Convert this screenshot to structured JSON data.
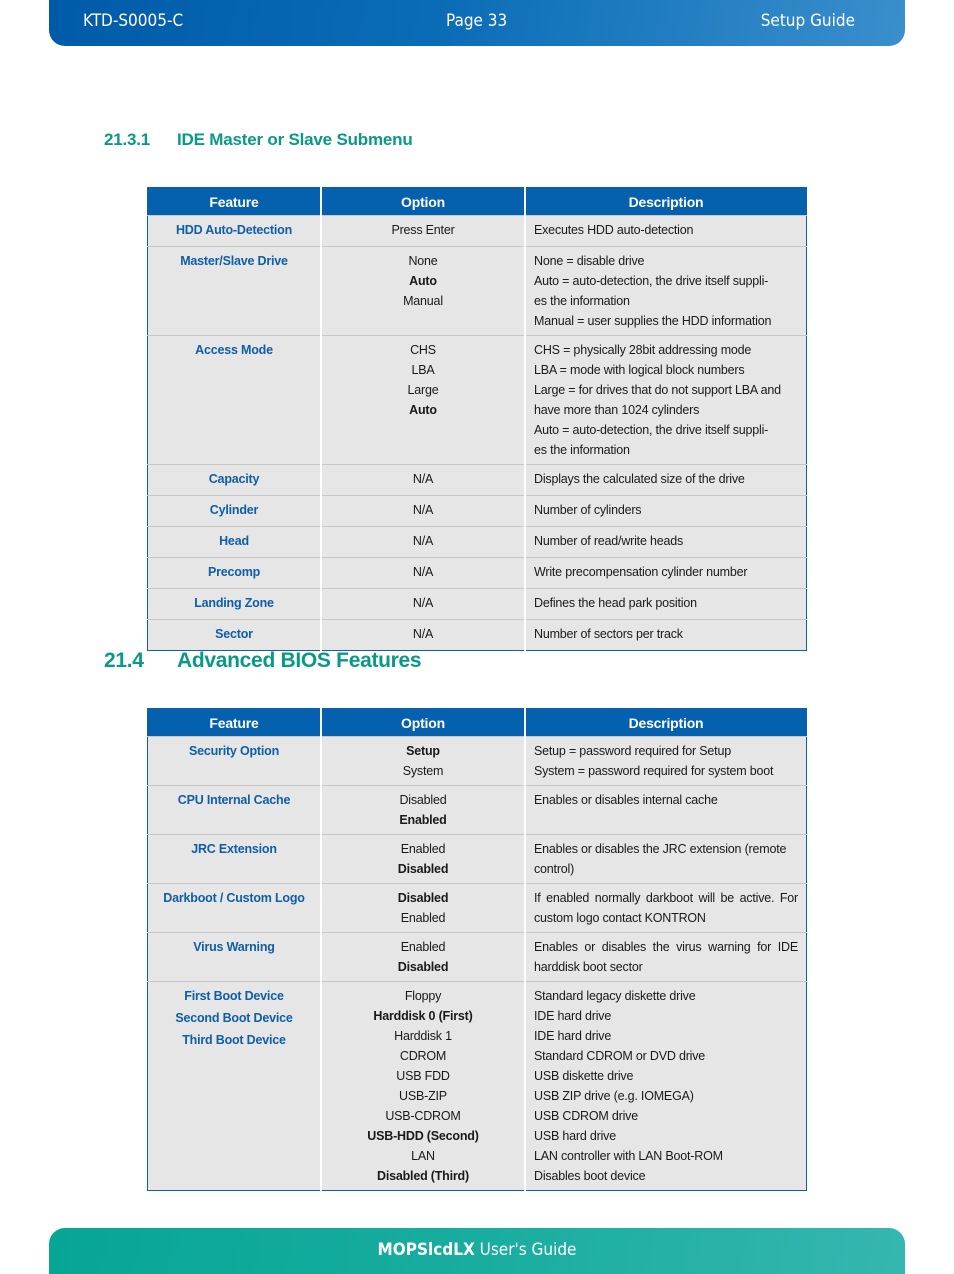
{
  "header": {
    "doc_id": "KTD-S0005-C",
    "page": "Page 33",
    "guide": "Setup Guide"
  },
  "section1": {
    "number": "21.3.1",
    "title": "IDE Master or Slave Submenu"
  },
  "section2": {
    "number": "21.4",
    "title": "Advanced BIOS Features"
  },
  "table_headers": {
    "feature": "Feature",
    "option": "Option",
    "description": "Description"
  },
  "table1": [
    {
      "feature": [
        "HDD Auto-Detection"
      ],
      "options": [
        {
          "t": "Press Enter",
          "b": false
        }
      ],
      "desc": [
        "Executes HDD auto-detection"
      ]
    },
    {
      "feature": [
        "Master/Slave Drive"
      ],
      "options": [
        {
          "t": "None",
          "b": false
        },
        {
          "t": "Auto",
          "b": true
        },
        {
          "t": "Manual",
          "b": false
        }
      ],
      "desc": [
        "None = disable drive",
        "Auto = auto-detection, the drive itself suppli-",
        "es the information",
        "Manual = user supplies the HDD information"
      ]
    },
    {
      "feature": [
        "Access Mode"
      ],
      "options": [
        {
          "t": "CHS",
          "b": false
        },
        {
          "t": "LBA",
          "b": false
        },
        {
          "t": "Large",
          "b": false
        },
        {
          "t": "Auto",
          "b": true
        }
      ],
      "desc": [
        "CHS = physically 28bit addressing mode",
        "LBA = mode with logical block numbers",
        "Large = for drives that do not support LBA and",
        "have more than 1024 cylinders",
        "Auto = auto-detection, the drive itself suppli-",
        "es the information"
      ]
    },
    {
      "feature": [
        "Capacity"
      ],
      "options": [
        {
          "t": "N/A",
          "b": false
        }
      ],
      "desc": [
        "Displays the calculated size of the drive"
      ]
    },
    {
      "feature": [
        "Cylinder"
      ],
      "options": [
        {
          "t": "N/A",
          "b": false
        }
      ],
      "desc": [
        "Number of cylinders"
      ]
    },
    {
      "feature": [
        "Head"
      ],
      "options": [
        {
          "t": "N/A",
          "b": false
        }
      ],
      "desc": [
        "Number of read/write heads"
      ]
    },
    {
      "feature": [
        "Precomp"
      ],
      "options": [
        {
          "t": "N/A",
          "b": false
        }
      ],
      "desc": [
        "Write precompensation cylinder number"
      ]
    },
    {
      "feature": [
        "Landing Zone"
      ],
      "options": [
        {
          "t": "N/A",
          "b": false
        }
      ],
      "desc": [
        "Defines the head park position"
      ]
    },
    {
      "feature": [
        "Sector"
      ],
      "options": [
        {
          "t": "N/A",
          "b": false
        }
      ],
      "desc": [
        "Number of sectors per track"
      ]
    }
  ],
  "table2": [
    {
      "feature": [
        "Security Option"
      ],
      "options": [
        {
          "t": "Setup",
          "b": true
        },
        {
          "t": "System",
          "b": false
        }
      ],
      "desc": [
        "Setup = password required for Setup",
        "System = password required for system boot"
      ]
    },
    {
      "feature": [
        "CPU Internal Cache"
      ],
      "options": [
        {
          "t": "Disabled",
          "b": false
        },
        {
          "t": "Enabled",
          "b": true
        }
      ],
      "desc": [
        "Enables or disables internal cache"
      ]
    },
    {
      "feature": [
        "JRC Extension"
      ],
      "options": [
        {
          "t": "Enabled",
          "b": false
        },
        {
          "t": "Disabled",
          "b": true
        }
      ],
      "desc": [
        "Enables or disables the JRC extension (remote control)"
      ]
    },
    {
      "feature": [
        "Darkboot / Custom Logo"
      ],
      "options": [
        {
          "t": "Disabled",
          "b": true
        },
        {
          "t": "Enabled",
          "b": false
        }
      ],
      "desc": [
        "If enabled normally darkboot will be active. For custom logo contact KONTRON"
      ],
      "justify": true
    },
    {
      "feature": [
        "Virus Warning"
      ],
      "options": [
        {
          "t": "Enabled",
          "b": false
        },
        {
          "t": "Disabled",
          "b": true
        }
      ],
      "desc": [
        "Enables or disables the virus warning for IDE harddisk boot sector"
      ],
      "justify": true
    },
    {
      "feature": [
        "First Boot Device",
        "Second Boot Device",
        "Third Boot Device"
      ],
      "options": [
        {
          "t": "Floppy",
          "b": false
        },
        {
          "t": "Harddisk 0 (First)",
          "b": true
        },
        {
          "t": "Harddisk 1",
          "b": false
        },
        {
          "t": "CDROM",
          "b": false
        },
        {
          "t": "USB FDD",
          "b": false
        },
        {
          "t": "USB-ZIP",
          "b": false
        },
        {
          "t": "USB-CDROM",
          "b": false
        },
        {
          "t": "USB-HDD (Second)",
          "b": true
        },
        {
          "t": "LAN",
          "b": false
        },
        {
          "t": "Disabled (Third)",
          "b": true
        }
      ],
      "desc": [
        "Standard legacy diskette drive",
        "IDE hard drive",
        "IDE hard drive",
        "Standard CDROM or DVD drive",
        "USB diskette drive",
        "USB ZIP drive (e.g. IOMEGA)",
        "USB CDROM drive",
        "USB hard drive",
        "LAN controller with LAN Boot-ROM",
        "Disables boot device"
      ]
    }
  ],
  "footer": {
    "product": "MOPSlcdLX",
    "suffix": " User's Guide"
  }
}
